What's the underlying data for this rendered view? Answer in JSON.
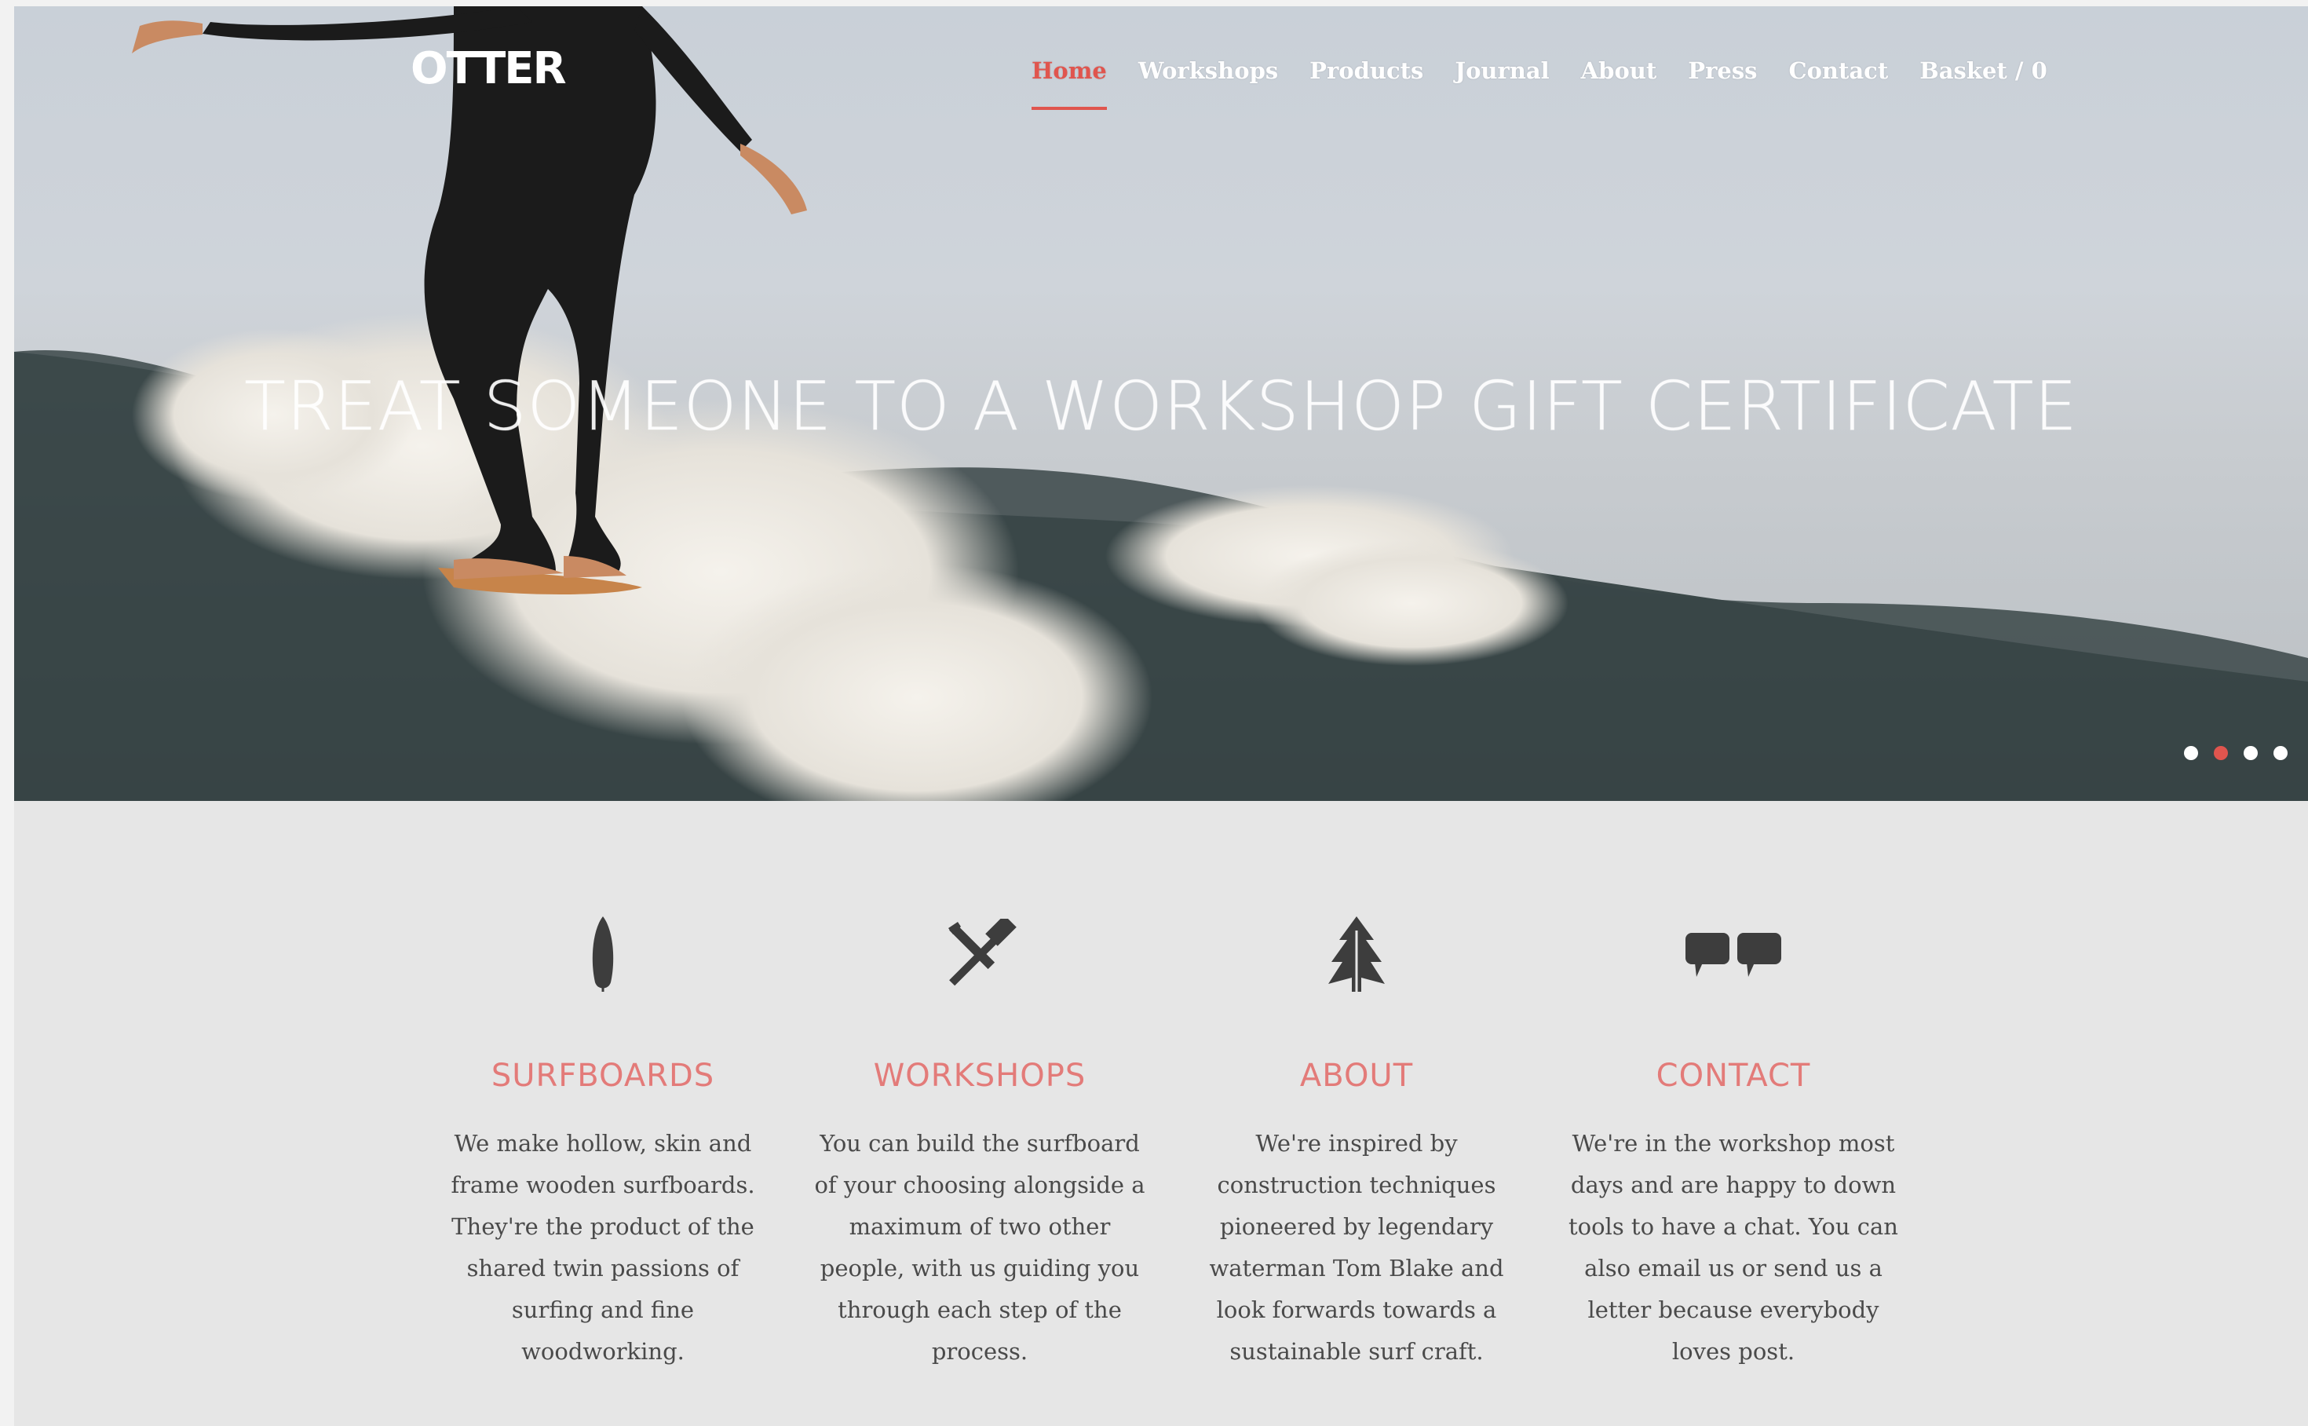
{
  "brand": {
    "logo_text": "OTTER"
  },
  "nav": {
    "items": [
      {
        "label": "Home",
        "active": true
      },
      {
        "label": "Workshops",
        "active": false
      },
      {
        "label": "Products",
        "active": false
      },
      {
        "label": "Journal",
        "active": false
      },
      {
        "label": "About",
        "active": false
      },
      {
        "label": "Press",
        "active": false
      },
      {
        "label": "Contact",
        "active": false
      },
      {
        "label": "Basket / 0",
        "active": false
      }
    ]
  },
  "hero": {
    "headline": "TREAT SOMEONE TO A WORKSHOP GIFT CERTIFICATE",
    "slider_dots": 4,
    "active_slide": 2
  },
  "features": [
    {
      "icon": "surfboard-icon",
      "title": "SURFBOARDS",
      "text": "We make hollow, skin and frame wooden surfboards. They're the product of the shared twin passions of surfing and fine woodworking."
    },
    {
      "icon": "tools-icon",
      "title": "WORKSHOPS",
      "text": "You can build the surfboard of your choosing alongside a maximum of two other people, with us guiding you through each step of the process."
    },
    {
      "icon": "tree-icon",
      "title": "ABOUT",
      "text": "We're inspired by construction techniques pioneered by legendary waterman Tom Blake and look forwards towards a sustainable surf craft."
    },
    {
      "icon": "speech-bubbles-icon",
      "title": "CONTACT",
      "text": "We're in the workshop most days and are happy to down tools to have a chat. You can also email us or send us a letter because everybody loves post."
    }
  ],
  "colors": {
    "accent": "#e0554e",
    "heading": "#e37b79",
    "body_text": "#4a4a4a",
    "section_bg": "#e6e6e6",
    "icon": "#3d3d3d"
  }
}
